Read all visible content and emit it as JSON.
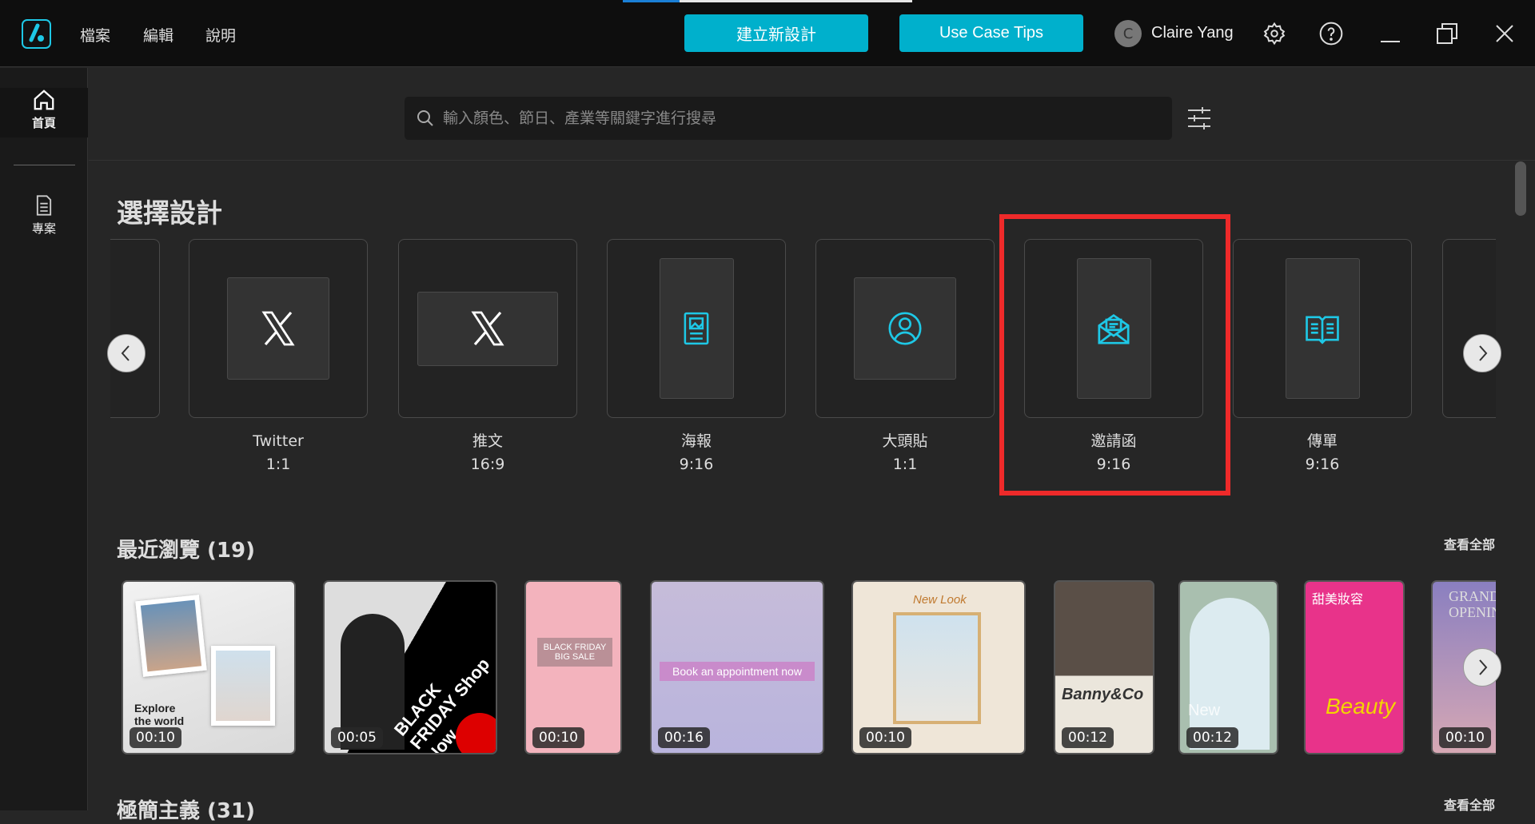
{
  "titlebar": {
    "menu": [
      "檔案",
      "編輯",
      "說明"
    ],
    "new_design_label": "建立新設計",
    "tips_label": "Use Case Tips",
    "user": {
      "initial": "C",
      "name": "Claire Yang"
    },
    "accent": "#00b0cc"
  },
  "sidebar": {
    "items": [
      {
        "label": "首頁",
        "icon": "home-icon"
      },
      {
        "label": "專案",
        "icon": "document-icon"
      }
    ]
  },
  "search": {
    "placeholder": "輸入顏色、節日、產業等關鍵字進行搜尋"
  },
  "design": {
    "title": "選擇設計",
    "cards": [
      {
        "name": "Twitter",
        "ratio": "1:1",
        "icon": "x-logo-icon"
      },
      {
        "name": "推文",
        "ratio": "16:9",
        "icon": "x-logo-icon"
      },
      {
        "name": "海報",
        "ratio": "9:16",
        "icon": "poster-icon"
      },
      {
        "name": "大頭貼",
        "ratio": "1:1",
        "icon": "profile-icon"
      },
      {
        "name": "邀請函",
        "ratio": "9:16",
        "icon": "envelope-icon",
        "highlighted": true
      },
      {
        "name": "傳單",
        "ratio": "9:16",
        "icon": "flyer-icon"
      }
    ],
    "highlight_color": "#ee2a2a"
  },
  "recent": {
    "title": "最近瀏覽 (19)",
    "see_all": "查看全部",
    "items": [
      {
        "duration": "00:10",
        "text": "Explore the world"
      },
      {
        "duration": "00:05",
        "text": "BLACK FRIDAY Shop Now"
      },
      {
        "duration": "00:10",
        "text": "BLACK FRIDAY BIG SALE"
      },
      {
        "duration": "00:16",
        "text": "Book an appointment now"
      },
      {
        "duration": "00:10",
        "text": "New Look"
      },
      {
        "duration": "00:12",
        "text": "Banny&Co"
      },
      {
        "duration": "00:12",
        "text": "New"
      },
      {
        "duration": "",
        "text": "甜美妝容"
      },
      {
        "duration": "00:10",
        "text": "GRAND OPENING"
      }
    ]
  },
  "minimal": {
    "title": "極簡主義 (31)",
    "see_all": "查看全部"
  }
}
